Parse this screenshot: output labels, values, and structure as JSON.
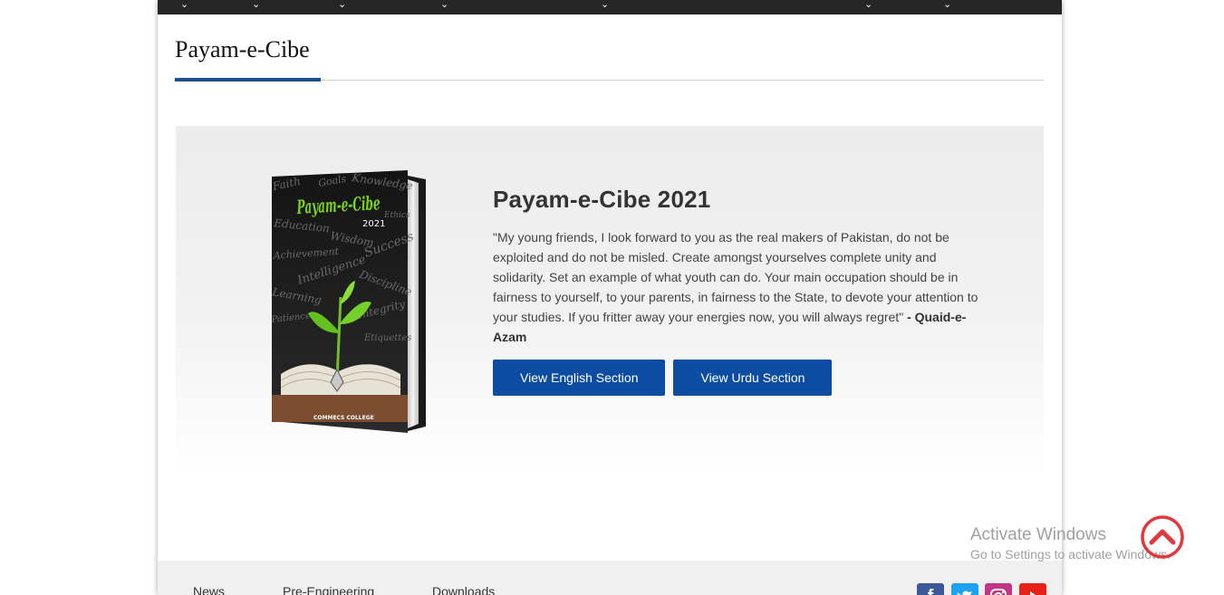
{
  "nav": {
    "chevron": "⌄"
  },
  "page": {
    "title": "Payam-e-Cibe"
  },
  "feature": {
    "heading": "Payam-e-Cibe 2021",
    "quote": "\"My young friends, I look forward to you as the real makers of Pakistan, do not be exploited and do not be misled. Create amongst yourselves complete unity and solidarity. Set an example of what youth can do. Your main occupation should be in fairness to yourself, to your parents, in fairness to the State, to devote your attention to your studies. If you fritter away your energies now, you will always regret\"",
    "attribution": "- Quaid-e-Azam",
    "buttons": {
      "english": "View English Section",
      "urdu": "View Urdu Section"
    }
  },
  "book": {
    "title": "Payam-e-Cibe",
    "year": "2021",
    "publisher": "COMMECS COLLEGE",
    "words": [
      "Faith",
      "Goals",
      "Knowledge",
      "Ethics",
      "Education",
      "Wisdom",
      "Success",
      "Achievement",
      "Intelligence",
      "Discipline",
      "Learning",
      "Integrity",
      "Patience",
      "Etiquettes"
    ]
  },
  "footer": {
    "links": [
      "News",
      "Pre-Engineering",
      "Downloads"
    ],
    "social": [
      "facebook-icon",
      "twitter-icon",
      "instagram-icon",
      "youtube-icon"
    ]
  },
  "watermark": {
    "line1": "Activate Windows",
    "line2": "Go to Settings to activate Windows."
  },
  "colors": {
    "accent": "#0d4da1",
    "underline": "#1d4f91",
    "navbar": "#262626",
    "scroll_top": "#e0393e"
  }
}
